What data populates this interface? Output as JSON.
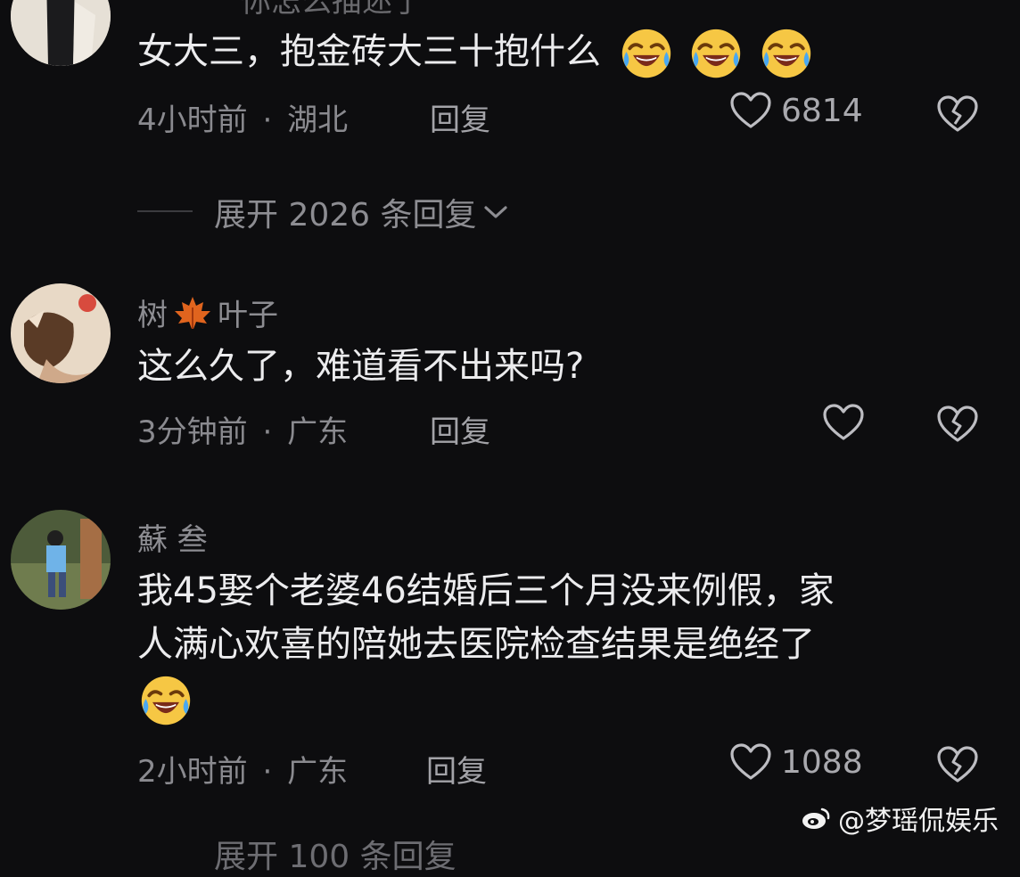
{
  "comments": [
    {
      "cut_text": "你怎么描述了",
      "text": "女大三，抱金砖大三十抱什么",
      "emoji_count": 3,
      "emoji": "rolling-laughing-emoji",
      "time": "4小时前",
      "location": "湖北",
      "reply": "回复",
      "likes": "6814"
    },
    {
      "user": "树",
      "user_suffix": "叶子",
      "user_emoji": "maple-leaf-emoji",
      "text": "这么久了，难道看不出来吗?",
      "time": "3分钟前",
      "location": "广东",
      "reply": "回复",
      "likes": ""
    },
    {
      "user": "蘇 叁",
      "text_line1": "我45娶个老婆46结婚后三个月没来例假，家",
      "text_line2": "人满心欢喜的陪她去医院检查结果是绝经了",
      "emoji": "rolling-laughing-emoji",
      "time": "2小时前",
      "location": "广东",
      "reply": "回复",
      "likes": "1088"
    }
  ],
  "expand": {
    "first": "展开 2026 条回复",
    "second": "展开 100 条回复"
  },
  "separator": "·",
  "watermark": "@梦瑶侃娱乐",
  "colors": {
    "background": "#0d0d0f",
    "text": "#ececee",
    "muted": "#8a8a8f"
  }
}
